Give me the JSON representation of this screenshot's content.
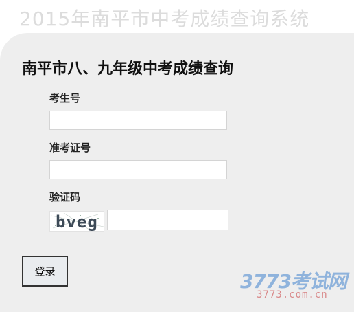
{
  "header": {
    "title": "2015年南平市中考成绩查询系统"
  },
  "form": {
    "title": "南平市八、九年级中考成绩查询",
    "student_id": {
      "label": "考生号",
      "value": "",
      "placeholder": ""
    },
    "admission_no": {
      "label": "准考证号",
      "value": "",
      "placeholder": ""
    },
    "captcha": {
      "label": "验证码",
      "image_text": "bveg",
      "value": "",
      "placeholder": ""
    },
    "login_label": "登录"
  },
  "watermark": {
    "logo": "3773考试网",
    "url": "3773.com.cn"
  },
  "colors": {
    "panel_bg": "#eeeeee",
    "header_text": "#dcdcdc",
    "button_bg": "#e9ecef",
    "watermark_logo": "#8fb3dc",
    "watermark_url": "#d9898a"
  }
}
